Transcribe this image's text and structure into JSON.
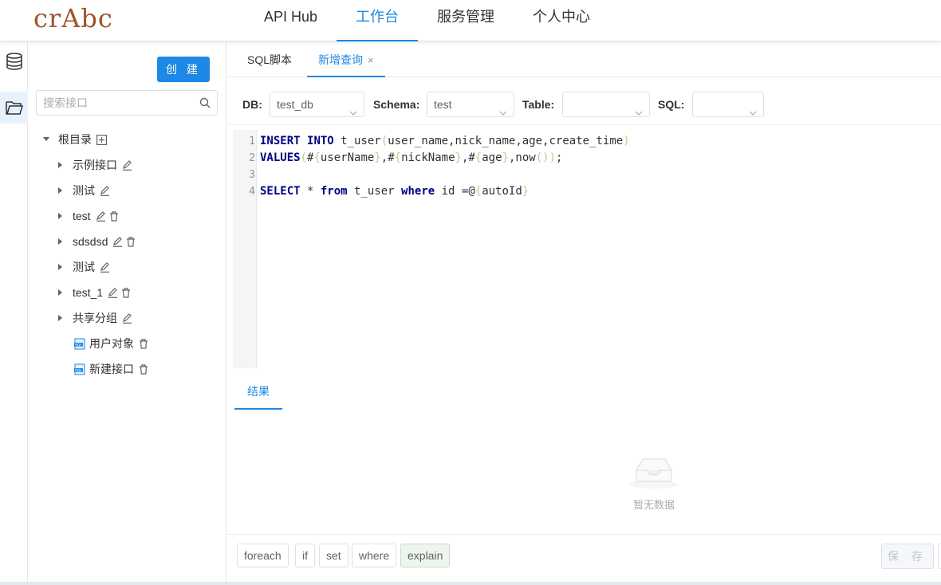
{
  "app": {
    "logo": "crAbc"
  },
  "nav": {
    "items": [
      {
        "label": "API Hub",
        "active": false
      },
      {
        "label": "工作台",
        "active": true
      },
      {
        "label": "服务管理",
        "active": false
      },
      {
        "label": "个人中心",
        "active": false
      }
    ]
  },
  "sidebar": {
    "create_label": "创 建",
    "search_placeholder": "搜索接口",
    "root_label": "根目录",
    "nodes": [
      {
        "label": "示例接口",
        "type": "folder"
      },
      {
        "label": "测试",
        "type": "folder"
      },
      {
        "label": "test",
        "type": "folder"
      },
      {
        "label": "sdsdsd",
        "type": "folder"
      },
      {
        "label": "测试",
        "type": "folder"
      },
      {
        "label": "test_1",
        "type": "folder"
      },
      {
        "label": "共享分组",
        "type": "folder"
      },
      {
        "label": "用户对象",
        "type": "sql"
      },
      {
        "label": "新建接口",
        "type": "sql"
      }
    ]
  },
  "tabs": [
    {
      "label": "SQL脚本",
      "active": false
    },
    {
      "label": "新增查询",
      "active": true,
      "close": "×"
    }
  ],
  "filters": {
    "db_label": "DB:",
    "db_value": "test_db",
    "schema_label": "Schema:",
    "schema_value": "test",
    "table_label": "Table:",
    "table_value": "",
    "sql_label": "SQL:",
    "sql_value": ""
  },
  "editor": {
    "line_numbers": [
      "1",
      "2",
      "3",
      "4"
    ],
    "lines": [
      "INSERT INTO t_user(user_name,nick_name,age,create_time)",
      "VALUES(#{userName},#{nickName},#{age},now());",
      "",
      "SELECT * from t_user where id =@{autoId}"
    ]
  },
  "result": {
    "tab_label": "结果",
    "empty_text": "暂无数据"
  },
  "toolbar": {
    "buttons": [
      "foreach",
      "if",
      "set",
      "where",
      "explain"
    ],
    "save_label": "保 存"
  },
  "colors": {
    "accent": "#1e88e5",
    "logo": "#a0522d"
  }
}
